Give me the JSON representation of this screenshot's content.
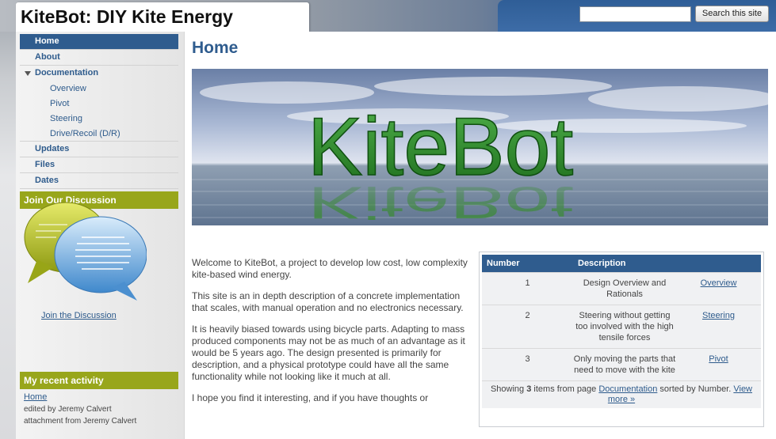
{
  "header": {
    "site_title": "KiteBot: DIY Kite Energy",
    "search": {
      "value": "",
      "button_label": "Search this site"
    }
  },
  "sidebar": {
    "nav": [
      {
        "label": "Home",
        "active": true
      },
      {
        "label": "About"
      },
      {
        "label": "Documentation",
        "expanded": true,
        "children": [
          "Overview",
          "Pivot",
          "Steering",
          "Drive/Recoil (D/R)"
        ]
      },
      {
        "label": "Updates"
      },
      {
        "label": "Files"
      },
      {
        "label": "Dates"
      }
    ],
    "discussion": {
      "title": "Join Our Discussion",
      "link": "Join the Discussion"
    },
    "activity": {
      "title": "My recent activity",
      "link": "Home",
      "lines": [
        "edited by Jeremy Calvert",
        "attachment from Jeremy Calvert"
      ]
    }
  },
  "main": {
    "heading": "Home",
    "banner_text": "KiteBot",
    "paragraphs": [
      "Welcome to KiteBot, a project to develop low cost, low complexity kite-based wind energy.",
      "This site is an in depth description of a concrete implementation that scales, with manual operation and no electronics necessary.",
      "It is heavily biased towards using bicycle parts.  Adapting to mass produced components may not be as much of an advantage as it would be 5 years ago.  The design presented is primarily for description, and a physical prototype could have all the same functionality while not looking like it much at all.",
      "I hope you find it interesting, and if you have thoughts or"
    ],
    "table": {
      "headers": [
        "Number",
        "Description"
      ],
      "rows": [
        {
          "number": "1",
          "description": "Design Overview and Rationals",
          "link": "Overview"
        },
        {
          "number": "2",
          "description": "Steering without getting too involved with the high tensile forces",
          "link": "Steering"
        },
        {
          "number": "3",
          "description": "Only moving the parts that need to move with the kite",
          "link": "Pivot"
        }
      ],
      "footer": {
        "prefix": "Showing",
        "count": "3",
        "middle": "items from page",
        "page_link": "Documentation",
        "suffix": "sorted by Number.",
        "view_more": "View more »"
      }
    }
  },
  "colors": {
    "nav_active": "#2f5c8e",
    "block_title": "#98a61b",
    "link": "#2e5b8c"
  }
}
